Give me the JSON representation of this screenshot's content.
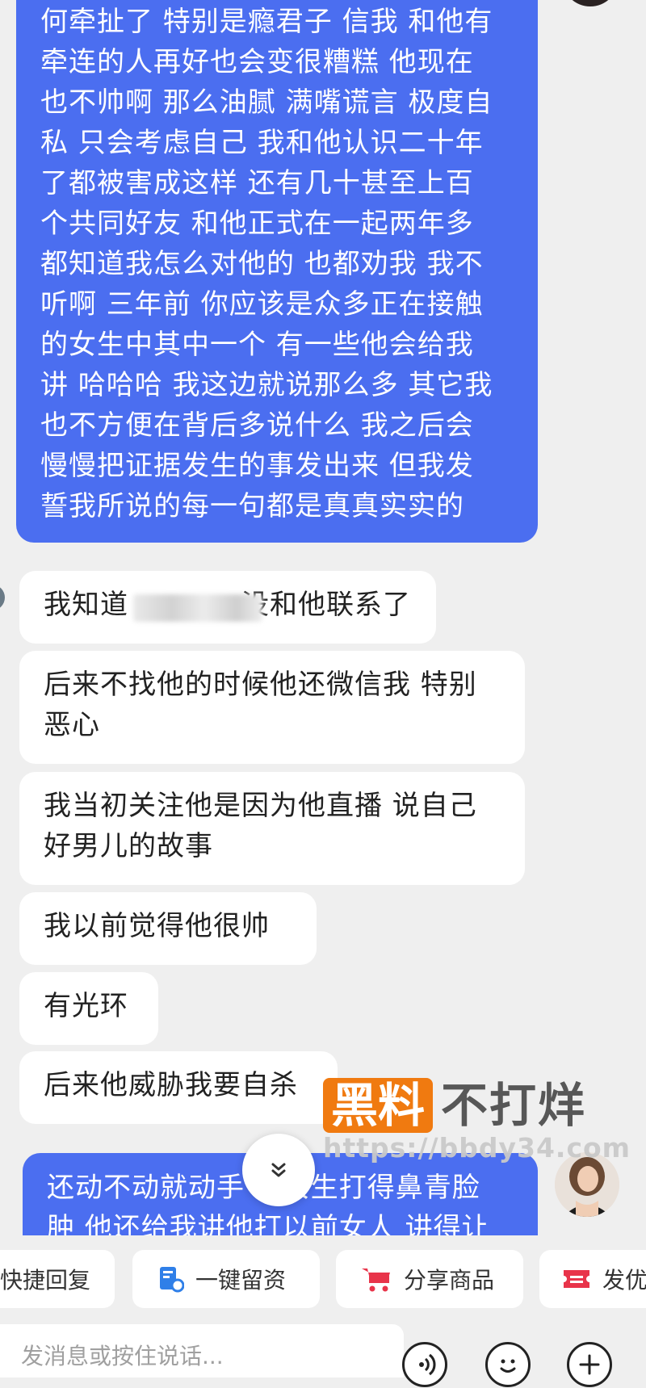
{
  "messages": {
    "outgoing_long": [
      "何牵扯了 特别是瘾君子 信我 和他有",
      "牵连的人再好也会变很糟糕 他现在",
      "也不帅啊 那么油腻 满嘴谎言 极度自",
      "私 只会考虑自己 我和他认识二十年",
      "了都被害成这样 还有几十甚至上百",
      "个共同好友 和他正式在一起两年多",
      "都知道我怎么对他的 也都劝我 我不",
      "听啊 三年前 你应该是众多正在接触",
      "的女生中其中一个 有一些他会给我",
      "讲 哈哈哈 我这边就说那么多 其它我",
      "也不方便在背后多说什么 我之后会",
      "慢慢把证据发生的事发出来 但我发",
      "誓我所说的每一句都是真真实实的"
    ],
    "incoming": [
      {
        "pre": "我知道",
        "post": "没和他联系了"
      },
      {
        "text": "后来不找他的时候他还微信我 特别恶心"
      },
      {
        "text": "我当初关注他是因为他直播 说自己好男儿的故事"
      },
      {
        "text": "我以前觉得他很帅"
      },
      {
        "text": "有光环"
      },
      {
        "text": "后来他威胁我要自杀"
      }
    ],
    "outgoing_bottom": [
      "还动不动就动手 把女生打得鼻青脸",
      "肿 他还给我讲他打以前女人 讲得让"
    ]
  },
  "watermark": {
    "badge": "黑料",
    "title": "不打烊",
    "url": "https://bbdy34.com",
    "badge_color": "#f07a10"
  },
  "quick_replies": [
    {
      "label": "快捷回复",
      "icon": ""
    },
    {
      "label": "一键留资",
      "icon": "form-icon"
    },
    {
      "label": "分享商品",
      "icon": "cart-icon"
    },
    {
      "label": "发优",
      "icon": "coupon-icon"
    }
  ],
  "input": {
    "placeholder": "发消息或按住说话..."
  },
  "colors": {
    "outgoing_bubble": "#4b6ef0",
    "incoming_bubble": "#ffffff",
    "background": "#efefef",
    "accent_red": "#e8344a",
    "accent_blue": "#2f7fe8"
  }
}
